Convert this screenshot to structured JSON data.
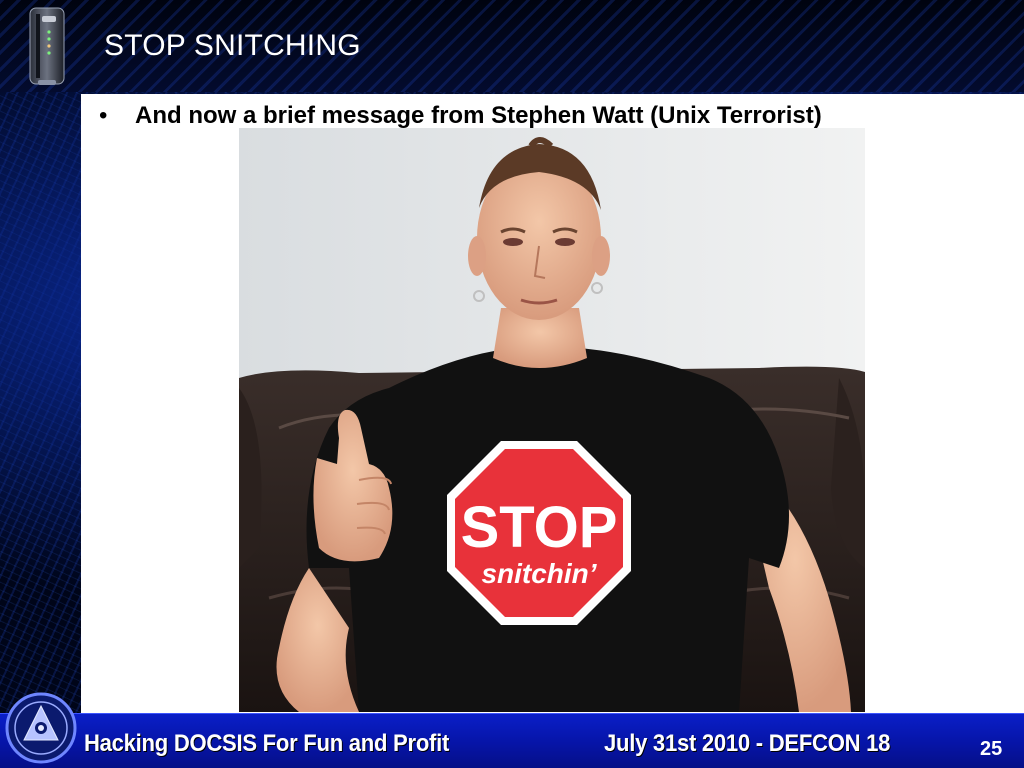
{
  "slide": {
    "title": "STOP SNITCHING",
    "bullet": "And now a brief message from Stephen Watt (Unix Terrorist)",
    "photo": {
      "sign_word_top": "STOP",
      "sign_word_bottom": "snitchin’"
    },
    "footer": {
      "left_text": "Hacking DOCSIS For Fun and Profit",
      "right_text": "July 31st 2010 - DEFCON 18",
      "slide_number": "25"
    }
  },
  "colors": {
    "footer_blue": "#0614a6",
    "background_dark": "#000519",
    "sign_red": "#e8323a",
    "panel_white": "#ffffff"
  },
  "icons": {
    "top_left": "cable-modem-icon",
    "bottom_left": "circular-emblem-icon"
  }
}
